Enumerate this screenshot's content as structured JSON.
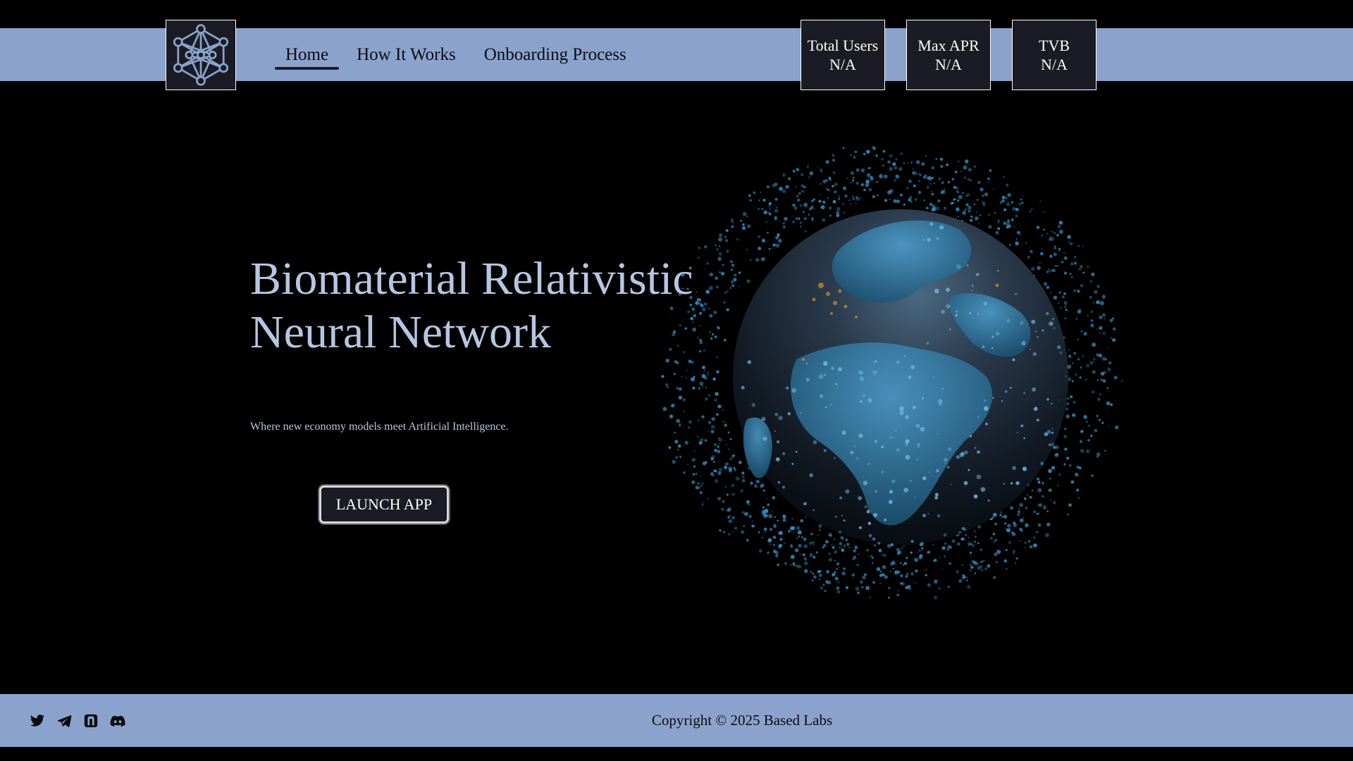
{
  "colors": {
    "band": "#8ba3cc",
    "panel": "#1a1b24",
    "hero_text": "#b6c6e2",
    "globe": "#3a8fc2"
  },
  "header": {
    "logo_icon": "neural-network-icon",
    "nav": [
      {
        "label": "Home",
        "active": true
      },
      {
        "label": "How It Works",
        "active": false
      },
      {
        "label": "Onboarding Process",
        "active": false
      }
    ],
    "stats": [
      {
        "label": "Total Users",
        "value": "N/A"
      },
      {
        "label": "Max APR",
        "value": "N/A"
      },
      {
        "label": "TVB",
        "value": "N/A"
      }
    ]
  },
  "hero": {
    "title_line1": "Biomaterial Relativistic",
    "title_line2": "Neural Network",
    "subtitle": "Where new economy models meet Artificial Intelligence.",
    "cta_label": "LAUNCH APP"
  },
  "footer": {
    "social_icons": [
      "twitter-icon",
      "telegram-icon",
      "gitbook-icon",
      "discord-icon"
    ],
    "copyright": "Copyright © 2025 Based Labs"
  }
}
